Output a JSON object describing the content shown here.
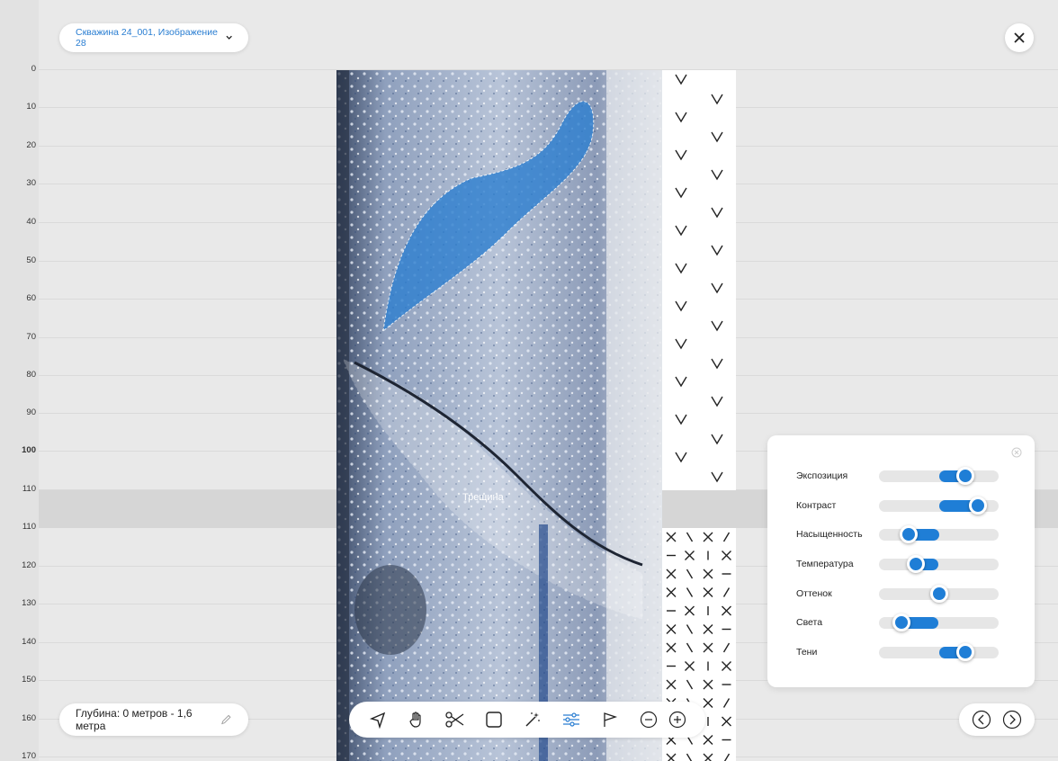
{
  "header": {
    "title": "Скважина 24_001, Изображение 28"
  },
  "ruler": {
    "ticks": [
      "0",
      "10",
      "20",
      "30",
      "40",
      "50",
      "60",
      "70",
      "80",
      "90",
      "100",
      "110",
      "110",
      "120",
      "130",
      "140",
      "150",
      "160",
      "170"
    ]
  },
  "annotation": {
    "crack_label": "Трещина"
  },
  "depth": {
    "label": "Глубина: 0 метров - 1,6 метра"
  },
  "toolbar": {
    "tools": [
      "pointer-icon",
      "hand-icon",
      "scissors-icon",
      "rectangle-icon",
      "magic-wand-icon",
      "adjust-sliders-icon",
      "flag-icon",
      "zoom-out-icon",
      "zoom-in-icon"
    ],
    "active": "adjust-sliders-icon",
    "accent": "#2a7ed2"
  },
  "adjustments": {
    "sliders": [
      {
        "label": "Экспозиция",
        "fill_from": 0.5,
        "value": 0.72
      },
      {
        "label": "Контраст",
        "fill_from": 0.5,
        "value": 0.83
      },
      {
        "label": "Насыщенность",
        "fill_from": 0.5,
        "value": 0.25
      },
      {
        "label": "Температура",
        "fill_from": 0.5,
        "value": 0.31
      },
      {
        "label": "Оттенок",
        "fill_from": 0.5,
        "value": 0.5
      },
      {
        "label": "Света",
        "fill_from": 0.5,
        "value": 0.19
      },
      {
        "label": "Тени",
        "fill_from": 0.5,
        "value": 0.72
      }
    ]
  },
  "colors": {
    "accent": "#1f7ed6",
    "background": "#e9e9e9",
    "band": "#d6d6d6"
  }
}
